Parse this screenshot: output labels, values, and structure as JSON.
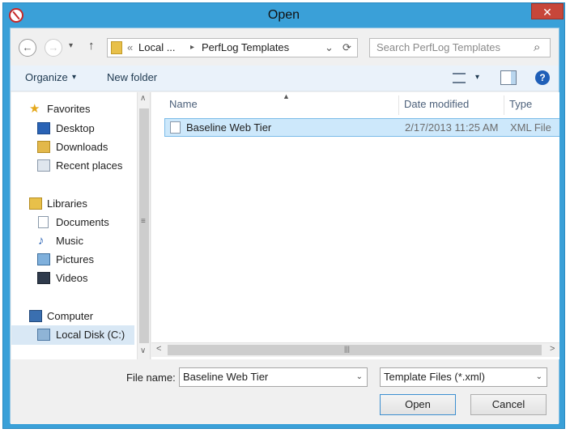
{
  "window": {
    "title": "Open",
    "close_glyph": "✕",
    "app_icon": "no-entry-icon"
  },
  "nav": {
    "back": "←",
    "forward": "→",
    "recent": "▾",
    "up": "↑",
    "address": {
      "prefix": "«",
      "seg1": "Local ...",
      "sep": "▸",
      "seg2": "PerfLog Templates",
      "dropdown": "⌄",
      "refresh": "⟳"
    },
    "search_placeholder": "Search PerfLog Templates",
    "search_icon": "⌕"
  },
  "toolbar": {
    "organize": "Organize",
    "organize_caret": "▾",
    "new_folder": "New folder",
    "view_caret": "▾",
    "help": "?"
  },
  "sidebar": {
    "items": [
      {
        "label": "Favorites",
        "icon": "star-icon"
      },
      {
        "label": "Desktop",
        "icon": "desktop-icon"
      },
      {
        "label": "Downloads",
        "icon": "downloads-icon"
      },
      {
        "label": "Recent places",
        "icon": "recent-places-icon"
      },
      {
        "label": "Libraries",
        "icon": "libraries-icon"
      },
      {
        "label": "Documents",
        "icon": "documents-icon"
      },
      {
        "label": "Music",
        "icon": "music-icon"
      },
      {
        "label": "Pictures",
        "icon": "pictures-icon"
      },
      {
        "label": "Videos",
        "icon": "videos-icon"
      },
      {
        "label": "Computer",
        "icon": "computer-icon"
      },
      {
        "label": "Local Disk (C:)",
        "icon": "disk-icon"
      }
    ],
    "scroll_up": "∧",
    "scroll_down": "∨",
    "grip": "≡"
  },
  "columns": {
    "name": "Name",
    "date": "Date modified",
    "type": "Type",
    "sort": "▲"
  },
  "files": [
    {
      "name": "Baseline Web Tier",
      "date": "2/17/2013 11:25 AM",
      "type": "XML File"
    }
  ],
  "hscroll": {
    "left": "<",
    "right": ">",
    "grip": "|||"
  },
  "footer": {
    "file_name_label": "File name:",
    "file_name_value": "Baseline Web Tier",
    "file_type_value": "Template Files (*.xml)",
    "open": "Open",
    "cancel": "Cancel",
    "caret": "⌄"
  },
  "colors": {
    "frame": "#3aa0d8",
    "selection": "#cde8fb",
    "close": "#c7463a"
  }
}
